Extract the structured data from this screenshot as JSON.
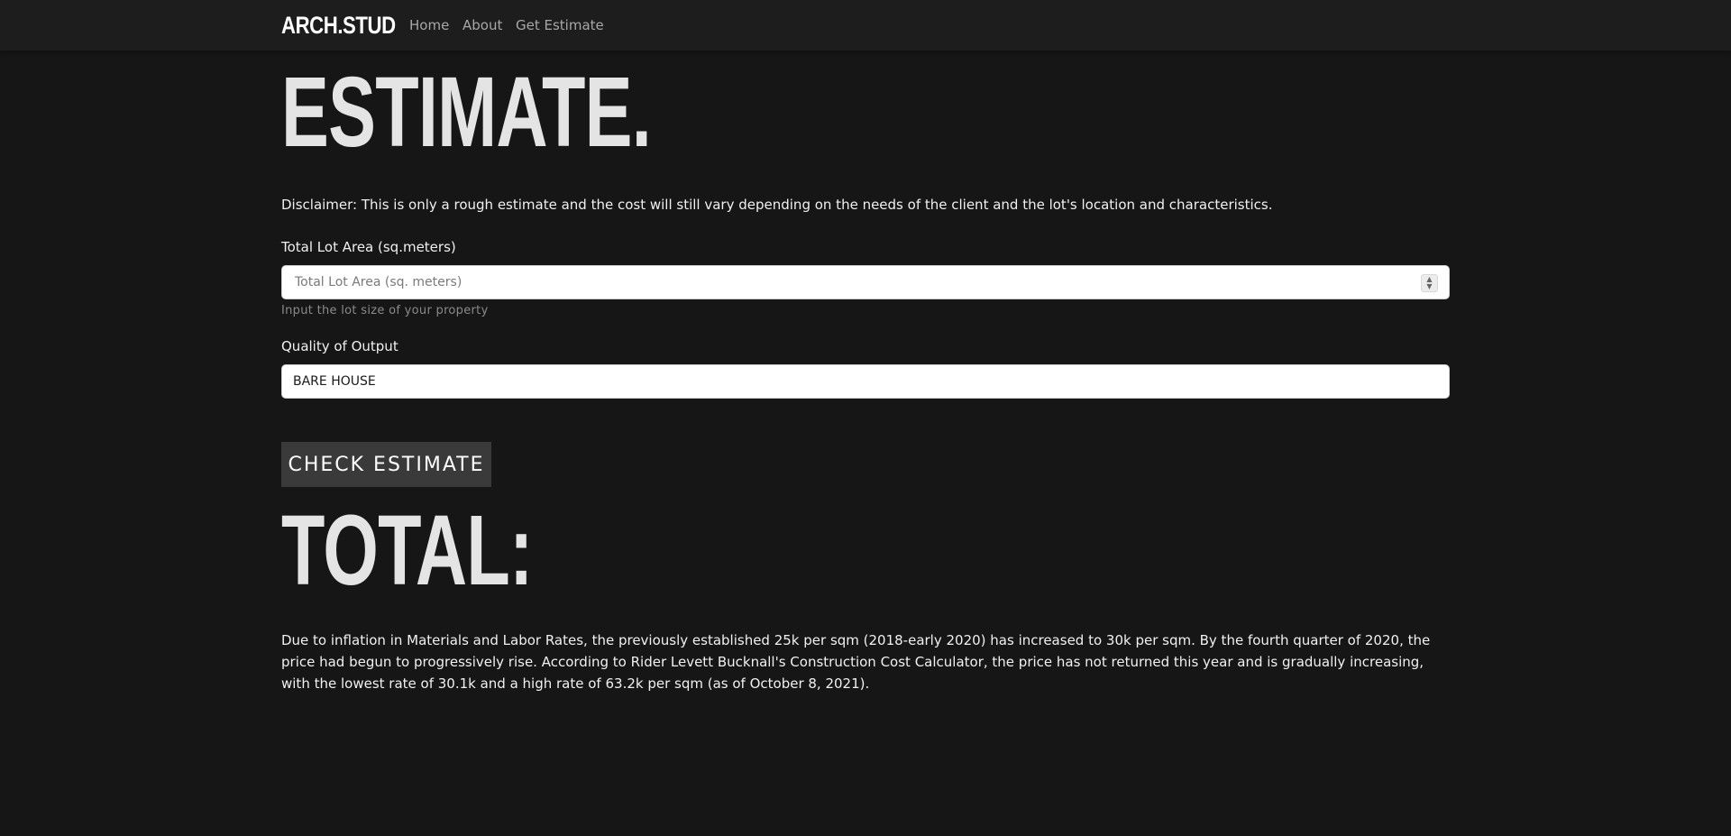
{
  "nav": {
    "brand": "ARCH.STUD",
    "links": [
      "Home",
      "About",
      "Get Estimate"
    ]
  },
  "main": {
    "title": "ESTIMATE.",
    "disclaimer": "Disclaimer: This is only a rough estimate and the cost will still vary depending on the needs of the client and the lot's location and characteristics.",
    "lot_area": {
      "label": "Total Lot Area (sq.meters)",
      "placeholder": "Total Lot Area (sq. meters)",
      "value": "",
      "help": "Input the lot size of your property"
    },
    "quality": {
      "label": "Quality of Output",
      "selected": "BARE HOUSE"
    },
    "button_label": "CHECK ESTIMATE",
    "total_title": "TOTAL:",
    "paragraph": "Due to inflation in Materials and Labor Rates, the previously established 25k per sqm (2018-early 2020) has increased to 30k per sqm. By the fourth quarter of 2020, the price had begun to progressively rise. According to Rider Levett Bucknall's Construction Cost Calculator, the price has not returned this year and is gradually increasing, with the lowest rate of 30.1k and a high rate of 63.2k per sqm (as of October 8, 2021)."
  },
  "colors": {
    "background": "#161616",
    "navbar": "#1d1d1d",
    "button": "#3a3a3a"
  },
  "icons": {
    "number_spinner": "up-down-arrows-icon"
  }
}
